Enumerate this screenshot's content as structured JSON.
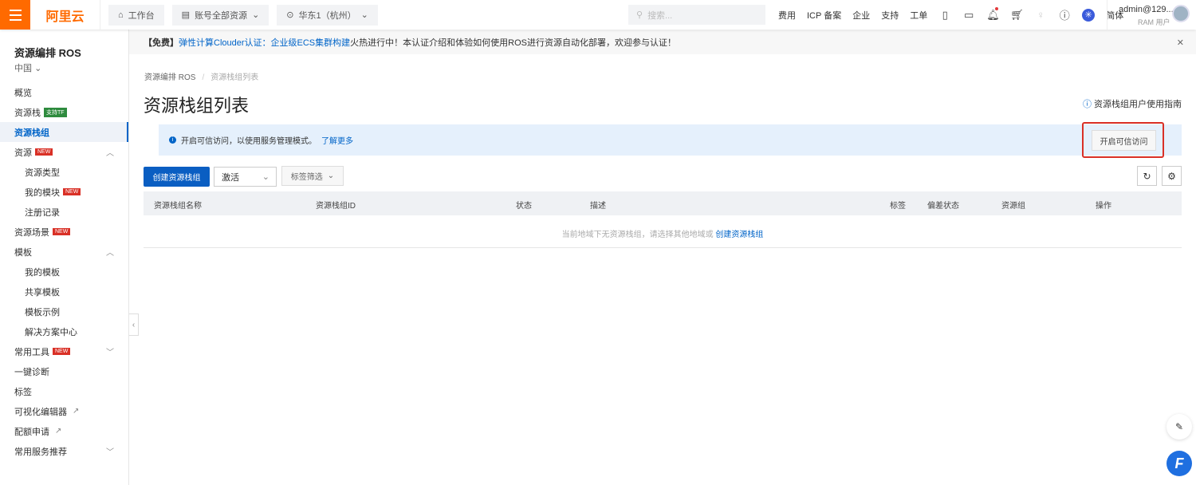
{
  "topbar": {
    "brand": "阿里云",
    "workbench": "工作台",
    "account": "账号全部资源",
    "region": "华东1（杭州）",
    "search_placeholder": "搜索...",
    "nav": [
      "费用",
      "ICP 备案",
      "企业",
      "支持",
      "工单"
    ],
    "lang": "简体",
    "user": "admin@129...",
    "user_role": "RAM 用户"
  },
  "banner": {
    "prefix": "【免费】",
    "link1": "弹性计算Clouder认证：",
    "link2": "企业级ECS集群构建",
    "text": "火热进行中！本认证介绍和体验如何使用ROS进行资源自动化部署，欢迎参与认证！"
  },
  "sidebar": {
    "title": "资源编排 ROS",
    "region": "中国",
    "items": [
      {
        "label": "概览"
      },
      {
        "label": "资源栈",
        "badge": "支持TF"
      },
      {
        "label": "资源栈组",
        "active": true
      },
      {
        "label": "资源",
        "badge": "NEW",
        "chevron": "up"
      },
      {
        "label": "资源类型",
        "sub": true
      },
      {
        "label": "我的模块",
        "sub": true,
        "badge": "NEW"
      },
      {
        "label": "注册记录",
        "sub": true
      },
      {
        "label": "资源场景",
        "badge": "NEW"
      },
      {
        "label": "模板",
        "chevron": "up"
      },
      {
        "label": "我的模板",
        "sub": true
      },
      {
        "label": "共享模板",
        "sub": true
      },
      {
        "label": "模板示例",
        "sub": true
      },
      {
        "label": "解决方案中心",
        "sub": true
      },
      {
        "label": "常用工具",
        "badge": "NEW",
        "chevron": "down"
      },
      {
        "label": "一键诊断"
      },
      {
        "label": "标签"
      },
      {
        "label": "可视化编辑器",
        "external": true
      },
      {
        "label": "配额申请",
        "external": true
      },
      {
        "label": "常用服务推荐",
        "chevron": "down"
      }
    ]
  },
  "breadcrumb": [
    "资源编排 ROS",
    "资源栈组列表"
  ],
  "page": {
    "title": "资源栈组列表",
    "guide": "资源栈组用户使用指南"
  },
  "notice": {
    "text": "开启可信访问，以使用服务管理模式。",
    "link": "了解更多",
    "button": "开启可信访问"
  },
  "toolbar": {
    "create": "创建资源栈组",
    "status_filter": "激活",
    "tag_filter": "标签筛选"
  },
  "table": {
    "columns": [
      "资源栈组名称",
      "资源栈组ID",
      "状态",
      "描述",
      "标签",
      "偏差状态",
      "资源组",
      "操作"
    ],
    "empty_text": "当前地域下无资源栈组，请选择其他地域或",
    "empty_link": "创建资源栈组"
  }
}
